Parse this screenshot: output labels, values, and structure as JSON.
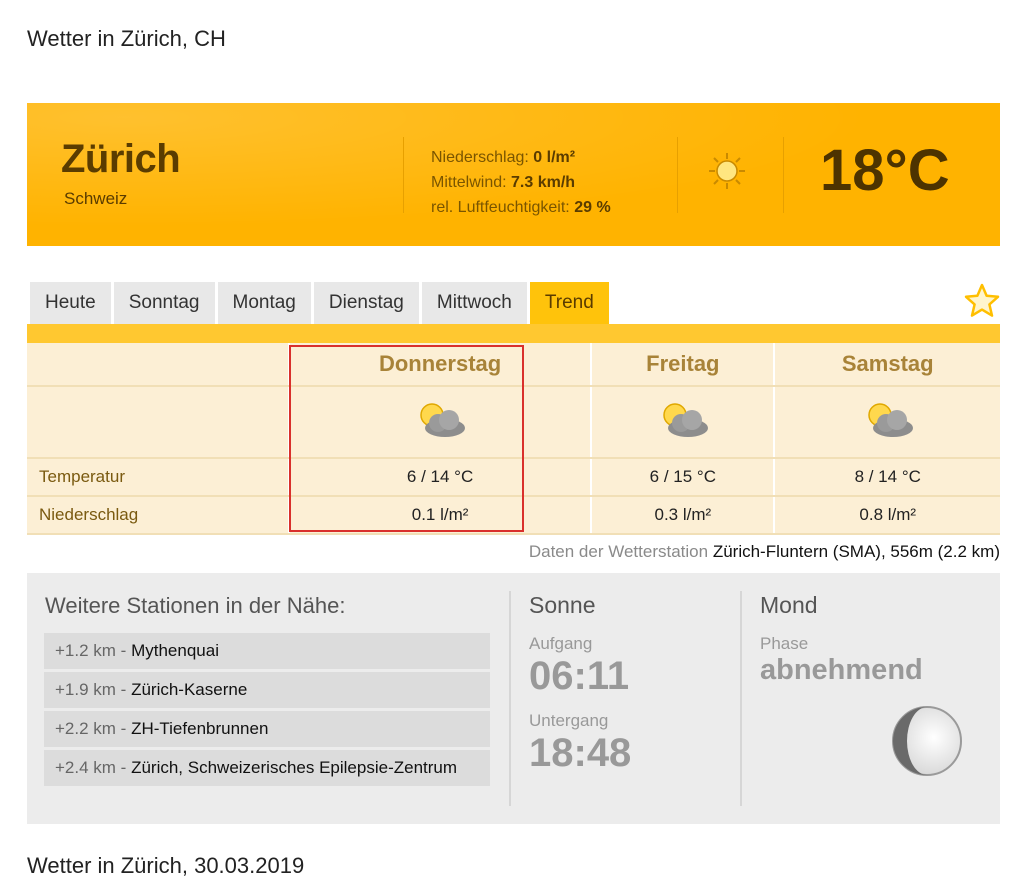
{
  "header": {
    "title": "Wetter in Zürich, CH"
  },
  "current": {
    "city": "Zürich",
    "country": "Schweiz",
    "precip_label": "Niederschlag:",
    "precip_value": "0 l/m²",
    "wind_label": "Mittelwind:",
    "wind_value": "7.3 km/h",
    "humidity_label": "rel. Luftfeuchtigkeit:",
    "humidity_value": "29 %",
    "temperature": "18°C",
    "condition_icon": "sun-icon"
  },
  "tabs": [
    {
      "label": "Heute",
      "active": false
    },
    {
      "label": "Sonntag",
      "active": false
    },
    {
      "label": "Montag",
      "active": false
    },
    {
      "label": "Dienstag",
      "active": false
    },
    {
      "label": "Mittwoch",
      "active": false
    },
    {
      "label": "Trend",
      "active": true
    }
  ],
  "favorite_icon": "star-icon",
  "forecast": {
    "row_labels": {
      "temperature": "Temperatur",
      "precipitation": "Niederschlag"
    },
    "days": [
      {
        "name": "Donnerstag",
        "icon": "partly-cloudy-icon",
        "temperature": "6 / 14 °C",
        "precipitation": "0.1 l/m²"
      },
      {
        "name": "Freitag",
        "icon": "partly-cloudy-icon",
        "temperature": "6 / 15 °C",
        "precipitation": "0.3 l/m²"
      },
      {
        "name": "Samstag",
        "icon": "partly-cloudy-icon",
        "temperature": "8 / 14 °C",
        "precipitation": "0.8 l/m²"
      }
    ]
  },
  "station": {
    "prefix": "Daten der Wetterstation",
    "name": "Zürich-Fluntern (SMA), 556m (2.2 km)"
  },
  "nearby": {
    "title": "Weitere Stationen in der Nähe:",
    "items": [
      {
        "distance": "+1.2 km -",
        "name": "Mythenquai"
      },
      {
        "distance": "+1.9 km -",
        "name": "Zürich-Kaserne"
      },
      {
        "distance": "+2.2 km -",
        "name": "ZH-Tiefenbrunnen"
      },
      {
        "distance": "+2.4 km -",
        "name": "Zürich, Schweizerisches Epilepsie-Zentrum"
      }
    ]
  },
  "sun": {
    "title": "Sonne",
    "rise_label": "Aufgang",
    "rise": "06:11",
    "set_label": "Untergang",
    "set": "18:48"
  },
  "moon": {
    "title": "Mond",
    "phase_label": "Phase",
    "phase": "abnehmend",
    "icon": "moon-icon"
  },
  "footer": {
    "title": "Wetter in Zürich, 30.03.2019"
  }
}
